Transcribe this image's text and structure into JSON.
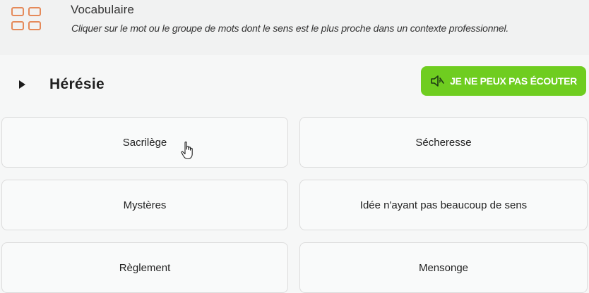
{
  "header": {
    "title": "Vocabulaire",
    "instruction": "Cliquer sur le mot ou le groupe de mots dont le sens est le plus proche dans un contexte professionnel."
  },
  "question": {
    "word": "Hérésie",
    "cant_listen_label": "JE NE PEUX PAS ÉCOUTER"
  },
  "choices": [
    "Sacrilège",
    "Sécheresse",
    "Mystères",
    "Idée n'ayant pas beaucoup de sens",
    "Règlement",
    "Mensonge"
  ],
  "colors": {
    "accent_green": "#6fcd20",
    "category_icon": "#e58a5a"
  },
  "icons": {
    "category": "grid-icon",
    "play": "play-icon",
    "mute": "speaker-muted-icon",
    "pointer": "hand-pointer-icon"
  }
}
